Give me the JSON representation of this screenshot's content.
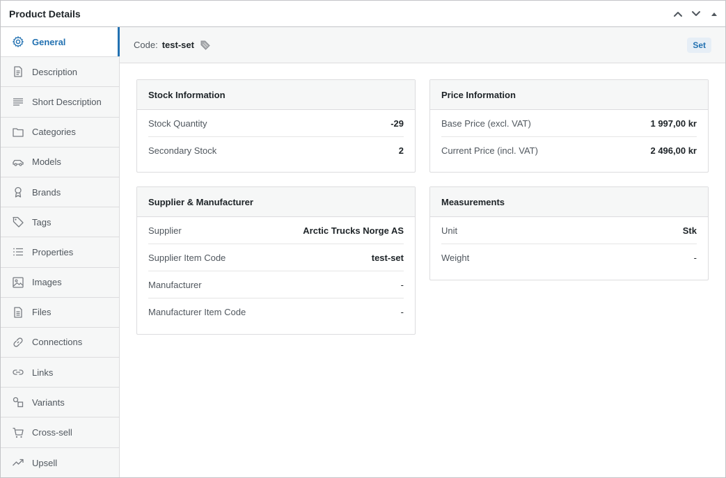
{
  "panel": {
    "title": "Product Details"
  },
  "sidebar": {
    "items": [
      {
        "label": "General",
        "icon": "gear-icon",
        "active": true
      },
      {
        "label": "Description",
        "icon": "document-icon"
      },
      {
        "label": "Short Description",
        "icon": "lines-icon"
      },
      {
        "label": "Categories",
        "icon": "folder-icon"
      },
      {
        "label": "Models",
        "icon": "car-icon"
      },
      {
        "label": "Brands",
        "icon": "award-icon"
      },
      {
        "label": "Tags",
        "icon": "tag-icon"
      },
      {
        "label": "Properties",
        "icon": "list-icon"
      },
      {
        "label": "Images",
        "icon": "image-icon"
      },
      {
        "label": "Files",
        "icon": "file-icon"
      },
      {
        "label": "Connections",
        "icon": "link-chain-icon"
      },
      {
        "label": "Links",
        "icon": "link-icon"
      },
      {
        "label": "Variants",
        "icon": "variants-icon"
      },
      {
        "label": "Cross-sell",
        "icon": "cart-icon"
      },
      {
        "label": "Upsell",
        "icon": "trend-up-icon"
      }
    ]
  },
  "code_bar": {
    "label": "Code:",
    "value": "test-set",
    "badge": "Set"
  },
  "stock": {
    "title": "Stock Information",
    "rows": [
      {
        "label": "Stock Quantity",
        "value": "-29"
      },
      {
        "label": "Secondary Stock",
        "value": "2"
      }
    ]
  },
  "price": {
    "title": "Price Information",
    "rows": [
      {
        "label": "Base Price (excl. VAT)",
        "value": "1 997,00 kr"
      },
      {
        "label": "Current Price (incl. VAT)",
        "value": "2 496,00 kr"
      }
    ]
  },
  "supplier": {
    "title": "Supplier & Manufacturer",
    "rows": [
      {
        "label": "Supplier",
        "value": "Arctic Trucks Norge AS"
      },
      {
        "label": "Supplier Item Code",
        "value": "test-set"
      },
      {
        "label": "Manufacturer",
        "value": "-"
      },
      {
        "label": "Manufacturer Item Code",
        "value": "-"
      }
    ]
  },
  "measurements": {
    "title": "Measurements",
    "rows": [
      {
        "label": "Unit",
        "value": "Stk"
      },
      {
        "label": "Weight",
        "value": "-"
      }
    ]
  },
  "colors": {
    "accent": "#2271b1",
    "border": "#dcdcde",
    "sidebar_bg": "#f6f7f7"
  }
}
